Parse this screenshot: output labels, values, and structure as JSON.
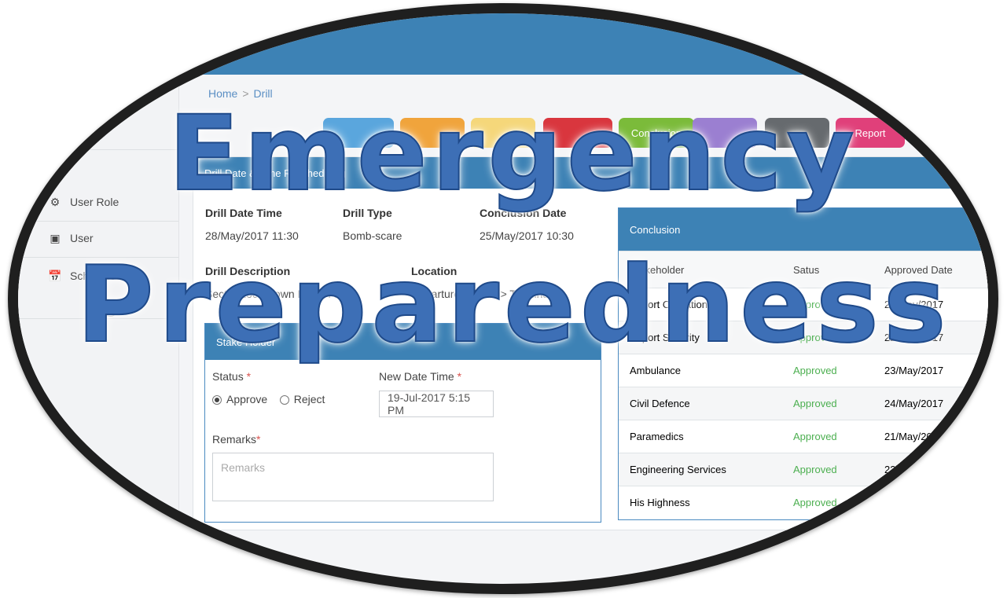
{
  "breadcrumb": {
    "home": "Home",
    "separator": ">",
    "current": "Drill"
  },
  "steps": [
    {
      "label": "",
      "color": "#5aa6dd"
    },
    {
      "label": "",
      "color": "#f0a43c"
    },
    {
      "label": "",
      "color": "#f5d77a"
    },
    {
      "label": "",
      "color": "#d9363e"
    },
    {
      "label": "Conclusion",
      "color": "#7bbb3a"
    },
    {
      "label": "",
      "color": "#9b7fd1"
    },
    {
      "label": "",
      "color": "#666a6e"
    },
    {
      "label": "Report",
      "color": "#e0407a"
    }
  ],
  "sidebar": {
    "items": [
      {
        "label": "User Role",
        "icon": "user-role-icon"
      },
      {
        "label": "User",
        "icon": "user-icon"
      },
      {
        "label": "Schedule",
        "icon": "calendar-icon"
      }
    ],
    "collapse_icon": "«"
  },
  "panel": {
    "title": "Drill Date & Time Rescheduling",
    "drill_date_time_label": "Drill Date Time",
    "drill_date_time": "28/May/2017 11:30",
    "drill_type_label": "Drill Type",
    "drill_type": "Bomb-scare",
    "conclusion_date_label": "Conclusion Date",
    "conclusion_date": "25/May/2017 10:30",
    "drill_description_label": "Drill Description",
    "drill_description": "Sector Lock Down Entire Area",
    "location_label": "Location",
    "location": "Departure Station > Terminal"
  },
  "stakeholder_form": {
    "title": "Stake Holder",
    "status_label": "Status",
    "approve_label": "Approve",
    "reject_label": "Reject",
    "new_date_time_label": "New Date Time",
    "new_date_time_value": "19-Jul-2017 5:15 PM",
    "remarks_label": "Remarks",
    "remarks_placeholder": "Remarks",
    "required_mark": "*"
  },
  "conclusion": {
    "title": "Conclusion",
    "columns": [
      "Stakeholder",
      "Satus",
      "Approved Date"
    ],
    "rows": [
      [
        "Airport Operations",
        "Approved",
        "21/May/2017"
      ],
      [
        "Airport Security",
        "Approved",
        "22/May/2017"
      ],
      [
        "Ambulance",
        "Approved",
        "23/May/2017"
      ],
      [
        "Civil Defence",
        "Approved",
        "24/May/2017"
      ],
      [
        "Paramedics",
        "Approved",
        "21/May/2017"
      ],
      [
        "Engineering Services",
        "Approved",
        "22/May/2017"
      ],
      [
        "His Highness",
        "Approved",
        "24/May/2017"
      ]
    ]
  },
  "overlay": {
    "line1": "Emergency",
    "line2": "Preparedness"
  }
}
